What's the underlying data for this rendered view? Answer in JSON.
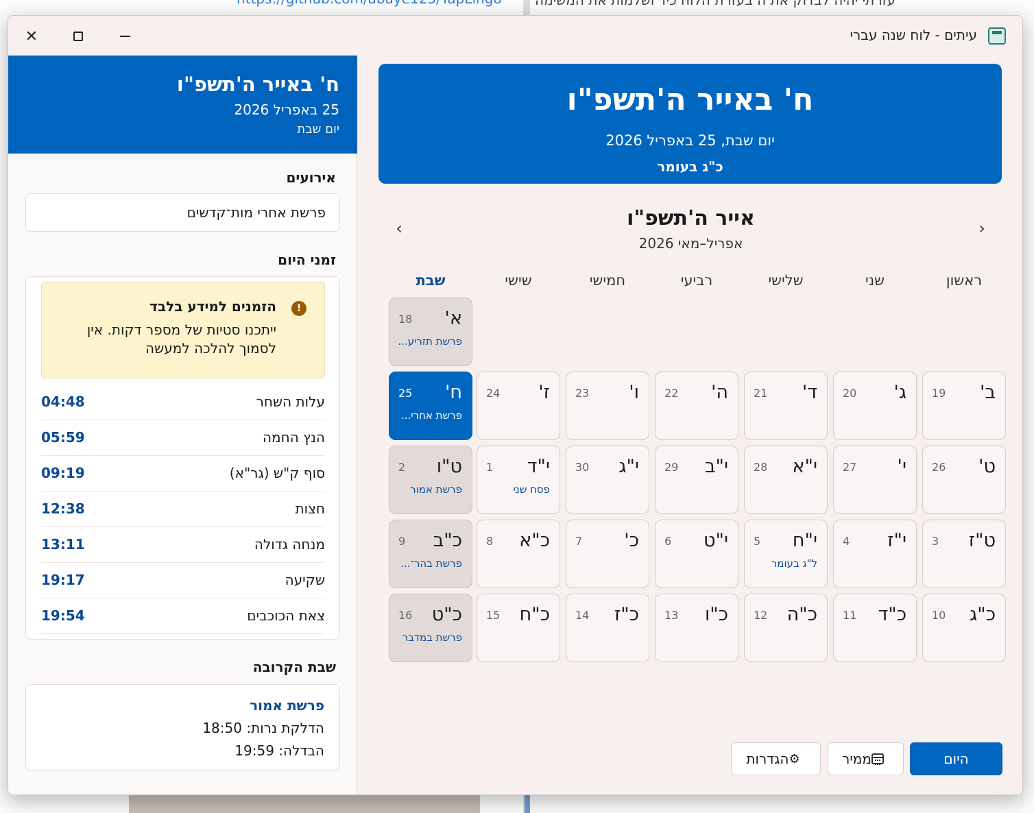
{
  "background": {
    "link": "https://github.com/abaye123/YapLingo",
    "snippet": "עזרתי יהיה לבדוק את ה בעזרת הלוח כיד ושלמות את המשימה"
  },
  "window": {
    "title": "עיתים - לוח שנה עברי",
    "app_icon": "calendar-app-icon",
    "controls": {
      "close": "✕",
      "maximize": "maximize",
      "minimize": "minimize"
    }
  },
  "side": {
    "hebrew_date": "ח' באייר ה'תשפ\"ו",
    "greg_date": "25 באפריל 2026",
    "weekday": "יום שבת",
    "events_title": "אירועים",
    "event": "פרשת אחרי מות־קדשים",
    "zmanim_title": "זמני היום",
    "warning": {
      "icon": "!",
      "title": "הזמנים למידע בלבד",
      "body": "ייתכנו סטיות של מספר דקות. אין לסמוך להלכה למעשה"
    },
    "zmanim": [
      {
        "label": "עלות השחר",
        "time": "04:48"
      },
      {
        "label": "הנץ החמה",
        "time": "05:59"
      },
      {
        "label": "סוף ק\"ש (גר\"א)",
        "time": "09:19"
      },
      {
        "label": "חצות",
        "time": "12:38"
      },
      {
        "label": "מנחה גדולה",
        "time": "13:11"
      },
      {
        "label": "שקיעה",
        "time": "19:17"
      },
      {
        "label": "צאת הכוכבים",
        "time": "19:54"
      }
    ],
    "shabbat_title": "שבת הקרובה",
    "shabbat": {
      "parasha": "פרשת אמור",
      "candles": "הדלקת נרות: 18:50",
      "havdala": "הבדלה: 19:59"
    }
  },
  "banner": {
    "hebrew_date": "ח' באייר ה'תשפ\"ו",
    "subtitle": "יום שבת, 25 באפריל 2026",
    "omer": "כ\"ג בעומר"
  },
  "calendar": {
    "month_title": "אייר ה'תשפ\"ו",
    "month_sub": "אפריל–מאי 2026",
    "prev_arrow": "‹",
    "next_arrow": "›",
    "weekdays": [
      "ראשון",
      "שני",
      "שלישי",
      "רביעי",
      "חמישי",
      "שישי",
      "שבת"
    ],
    "weeks": [
      [
        null,
        null,
        null,
        null,
        null,
        null,
        {
          "heb": "א'",
          "greg": "18",
          "note": "פרשת תזריע..."
        }
      ],
      [
        {
          "heb": "ב'",
          "greg": "19",
          "note": ""
        },
        {
          "heb": "ג'",
          "greg": "20",
          "note": ""
        },
        {
          "heb": "ד'",
          "greg": "21",
          "note": ""
        },
        {
          "heb": "ה'",
          "greg": "22",
          "note": ""
        },
        {
          "heb": "ו'",
          "greg": "23",
          "note": ""
        },
        {
          "heb": "ז'",
          "greg": "24",
          "note": ""
        },
        {
          "heb": "ח'",
          "greg": "25",
          "note": "פרשת אחרי...",
          "today": true
        }
      ],
      [
        {
          "heb": "ט'",
          "greg": "26",
          "note": ""
        },
        {
          "heb": "י'",
          "greg": "27",
          "note": ""
        },
        {
          "heb": "י\"א",
          "greg": "28",
          "note": ""
        },
        {
          "heb": "י\"ב",
          "greg": "29",
          "note": ""
        },
        {
          "heb": "י\"ג",
          "greg": "30",
          "note": ""
        },
        {
          "heb": "י\"ד",
          "greg": "1",
          "note": "פסח שני"
        },
        {
          "heb": "ט\"ו",
          "greg": "2",
          "note": "פרשת אמור"
        }
      ],
      [
        {
          "heb": "ט\"ז",
          "greg": "3",
          "note": ""
        },
        {
          "heb": "י\"ז",
          "greg": "4",
          "note": ""
        },
        {
          "heb": "י\"ח",
          "greg": "5",
          "note": "ל\"ג בעומר"
        },
        {
          "heb": "י\"ט",
          "greg": "6",
          "note": ""
        },
        {
          "heb": "כ'",
          "greg": "7",
          "note": ""
        },
        {
          "heb": "כ\"א",
          "greg": "8",
          "note": ""
        },
        {
          "heb": "כ\"ב",
          "greg": "9",
          "note": "פרשת בהר־..."
        }
      ],
      [
        {
          "heb": "כ\"ג",
          "greg": "10",
          "note": ""
        },
        {
          "heb": "כ\"ד",
          "greg": "11",
          "note": ""
        },
        {
          "heb": "כ\"ה",
          "greg": "12",
          "note": ""
        },
        {
          "heb": "כ\"ו",
          "greg": "13",
          "note": ""
        },
        {
          "heb": "כ\"ז",
          "greg": "14",
          "note": ""
        },
        {
          "heb": "כ\"ח",
          "greg": "15",
          "note": ""
        },
        {
          "heb": "כ\"ט",
          "greg": "16",
          "note": "פרשת במדבר"
        }
      ]
    ]
  },
  "buttons": {
    "today": "היום",
    "converter": "ממיר",
    "settings": "הגדרות"
  },
  "colors": {
    "accent": "#0067c0",
    "link": "#0b4a94",
    "warning_bg": "#fdf3cd",
    "shabbat_cell": "#e2dad8"
  }
}
